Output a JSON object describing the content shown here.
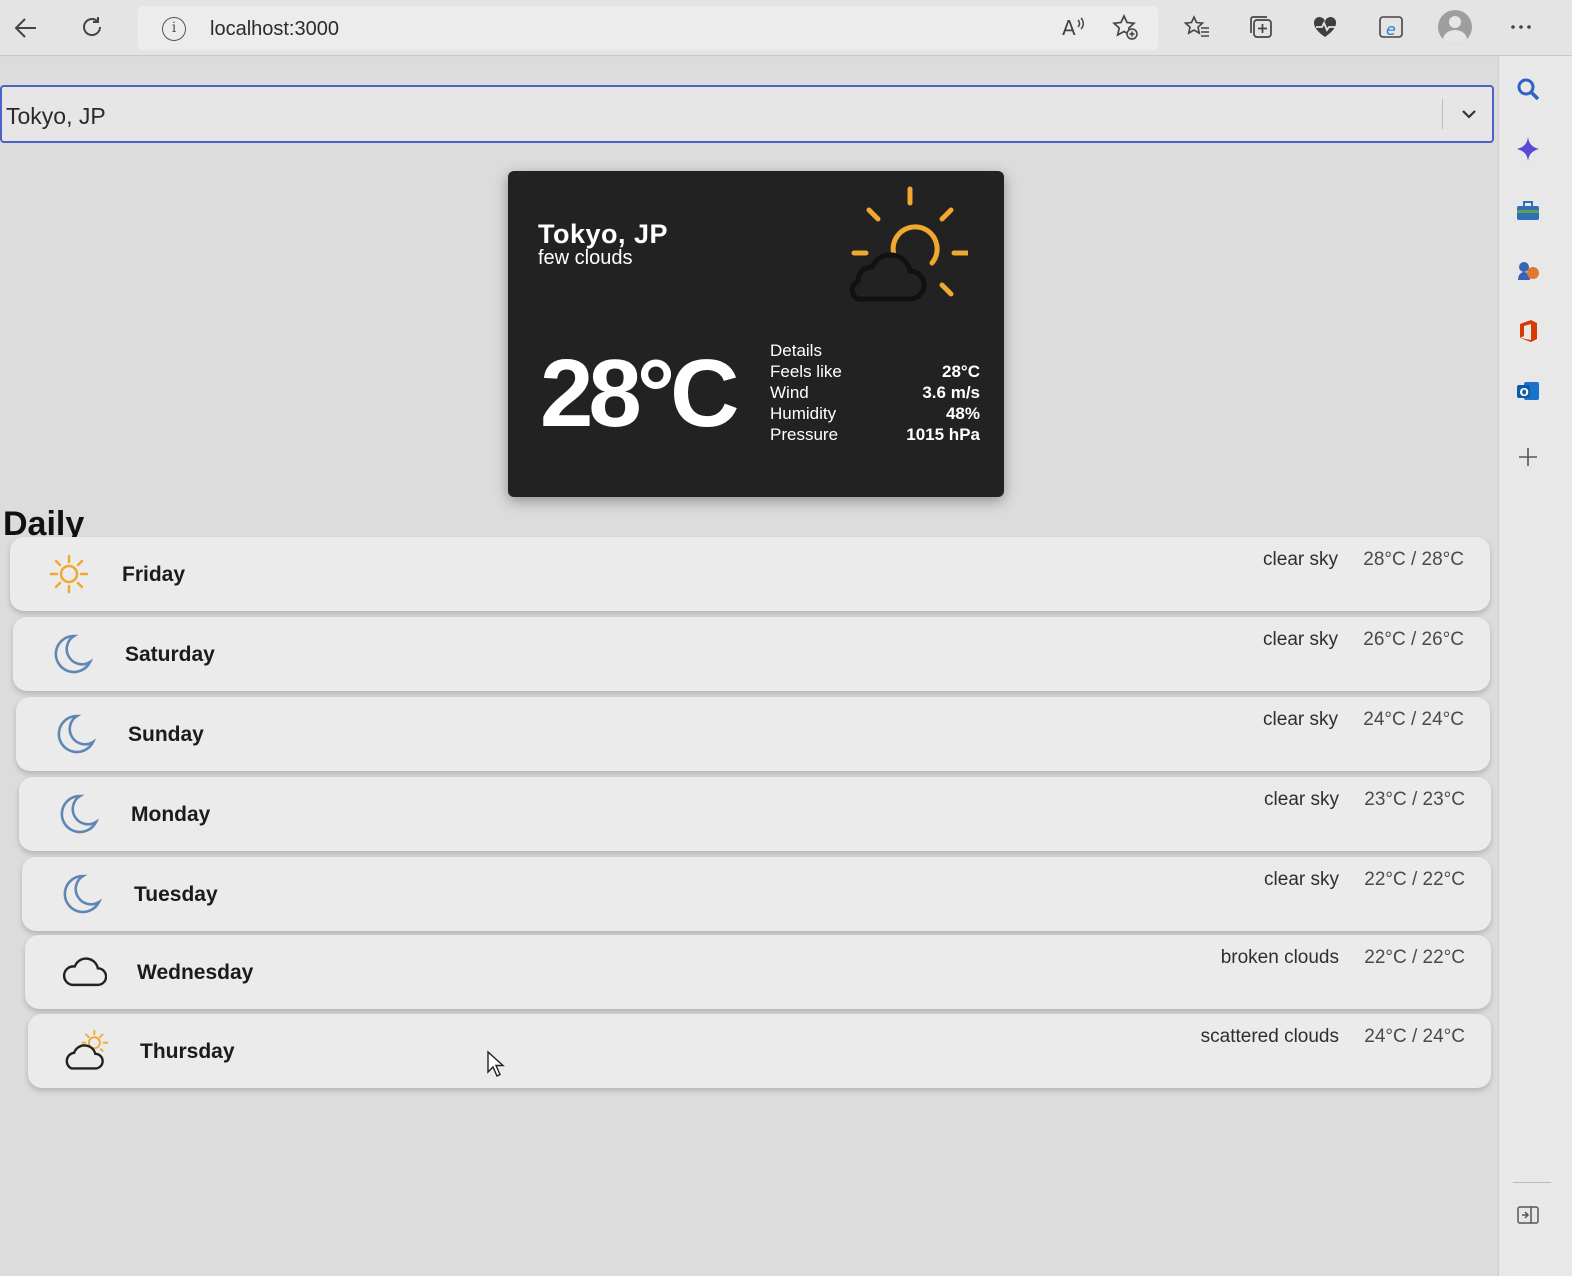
{
  "browser": {
    "url": "localhost:3000"
  },
  "search": {
    "selected_city": "Tokyo, JP"
  },
  "current": {
    "city": "Tokyo, JP",
    "description": "few clouds",
    "temperature": "28°C",
    "icon": "few-clouds-day-icon",
    "details_title": "Details",
    "details": [
      {
        "label": "Feels like",
        "value": "28°C"
      },
      {
        "label": "Wind",
        "value": "3.6 m/s"
      },
      {
        "label": "Humidity",
        "value": "48%"
      },
      {
        "label": "Pressure",
        "value": "1015 hPa"
      }
    ]
  },
  "daily": {
    "title": "Daily",
    "items": [
      {
        "day": "Friday",
        "description": "clear sky",
        "temps": "28°C / 28°C",
        "icon": "sun-icon"
      },
      {
        "day": "Saturday",
        "description": "clear sky",
        "temps": "26°C / 26°C",
        "icon": "moon-icon"
      },
      {
        "day": "Sunday",
        "description": "clear sky",
        "temps": "24°C / 24°C",
        "icon": "moon-icon"
      },
      {
        "day": "Monday",
        "description": "clear sky",
        "temps": "23°C / 23°C",
        "icon": "moon-icon"
      },
      {
        "day": "Tuesday",
        "description": "clear sky",
        "temps": "22°C / 22°C",
        "icon": "moon-icon"
      },
      {
        "day": "Wednesday",
        "description": "broken clouds",
        "temps": "22°C / 22°C",
        "icon": "cloud-icon"
      },
      {
        "day": "Thursday",
        "description": "scattered clouds",
        "temps": "24°C / 24°C",
        "icon": "sun-cloud-icon"
      }
    ]
  },
  "colors": {
    "accent_border": "#4b63c9",
    "card_bg": "#222222",
    "sun": "#f0a830",
    "moon": "#5f87b3"
  }
}
